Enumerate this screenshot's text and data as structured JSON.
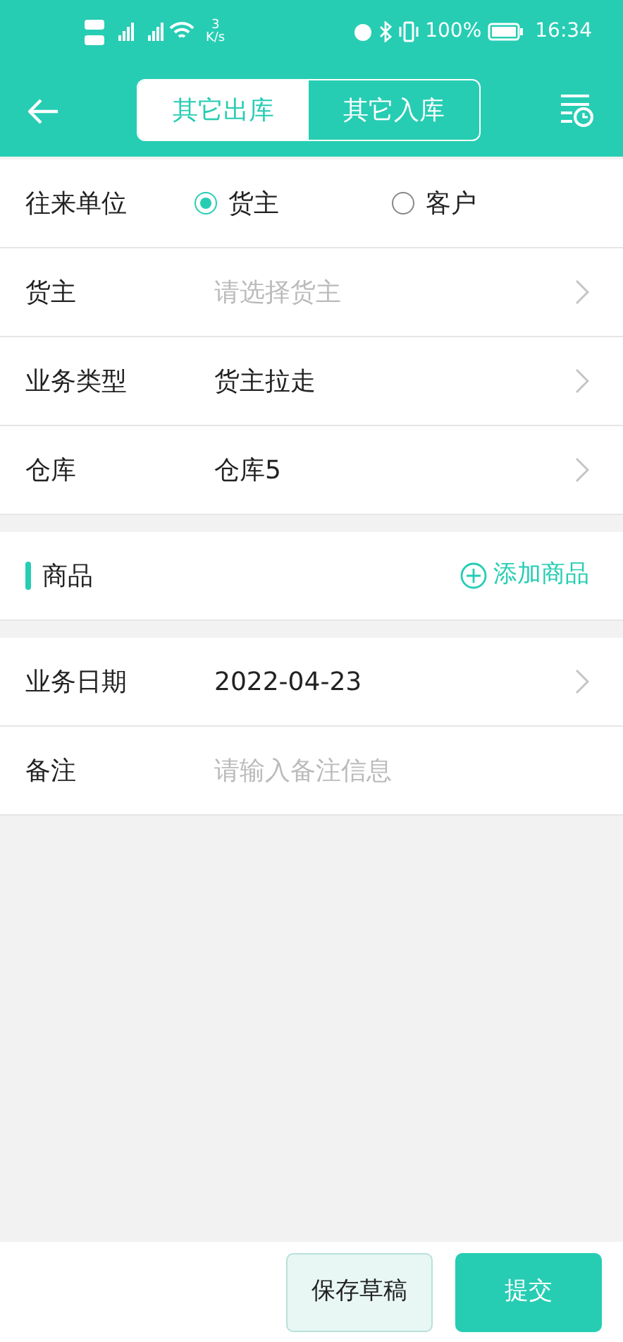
{
  "status_bar": {
    "speed": "3",
    "speed_unit": "K/s",
    "battery": "100%",
    "time": "16:34"
  },
  "header": {
    "tabs": [
      {
        "label": "其它出库",
        "selected": true
      },
      {
        "label": "其它入库",
        "selected": false
      }
    ]
  },
  "sections": [
    {
      "kind": "form",
      "rows": [
        {
          "kind": "radio",
          "label": "往来单位",
          "options": [
            {
              "label": "货主",
              "selected": true
            },
            {
              "label": "客户",
              "selected": false
            }
          ]
        },
        {
          "kind": "select",
          "label": "货主",
          "placeholder": "请选择货主"
        },
        {
          "kind": "select",
          "label": "业务类型",
          "value": "货主拉走"
        },
        {
          "kind": "select",
          "label": "仓库",
          "value": "仓库5"
        }
      ]
    },
    {
      "kind": "goods",
      "title": "商品",
      "action": "添加商品"
    },
    {
      "kind": "form",
      "rows": [
        {
          "kind": "select",
          "label": "业务日期",
          "value": "2022-04-23"
        },
        {
          "kind": "input",
          "label": "备注",
          "placeholder": "请输入备注信息"
        }
      ]
    }
  ],
  "buttons": [
    {
      "label": "保存草稿",
      "kind": "secondary"
    },
    {
      "label": "提交",
      "kind": "primary"
    }
  ]
}
